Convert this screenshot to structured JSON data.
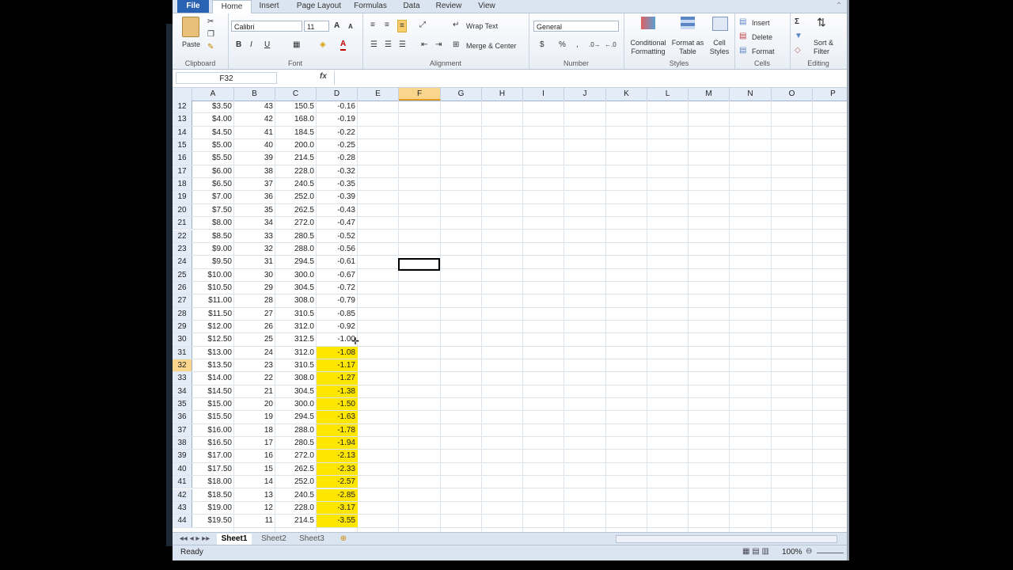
{
  "ribbon_tabs": [
    "File",
    "Home",
    "Insert",
    "Page Layout",
    "Formulas",
    "Data",
    "Review",
    "View"
  ],
  "clipboard": {
    "paste": "Paste",
    "label": "Clipboard"
  },
  "font": {
    "name": "Calibri",
    "size": "11",
    "label": "Font"
  },
  "alignment": {
    "wrap": "Wrap Text",
    "merge": "Merge & Center",
    "label": "Alignment"
  },
  "number": {
    "format": "General",
    "dollar": "$",
    "percent": "%",
    "comma": ",",
    "label": "Number"
  },
  "styles": {
    "conditional": "Conditional Formatting",
    "format_table": "Format as Table",
    "cell_styles": "Cell Styles",
    "label": "Styles"
  },
  "cells": {
    "insert": "Insert",
    "delete": "Delete",
    "format": "Format",
    "label": "Cells"
  },
  "editing": {
    "sort": "Sort & Filter",
    "label": "Editing",
    "sigma": "Σ"
  },
  "namebox": "F32",
  "fx": "fx",
  "columns": [
    "A",
    "B",
    "C",
    "D",
    "E",
    "F",
    "G",
    "H",
    "I",
    "J",
    "K",
    "L",
    "M",
    "N",
    "O",
    "P"
  ],
  "selected_col": "F",
  "selected_row": "32",
  "rows": [
    {
      "n": "12",
      "a": "$3.50",
      "b": "43",
      "c": "150.5",
      "d": "-0.16",
      "hl": false
    },
    {
      "n": "13",
      "a": "$4.00",
      "b": "42",
      "c": "168.0",
      "d": "-0.19",
      "hl": false
    },
    {
      "n": "14",
      "a": "$4.50",
      "b": "41",
      "c": "184.5",
      "d": "-0.22",
      "hl": false
    },
    {
      "n": "15",
      "a": "$5.00",
      "b": "40",
      "c": "200.0",
      "d": "-0.25",
      "hl": false
    },
    {
      "n": "16",
      "a": "$5.50",
      "b": "39",
      "c": "214.5",
      "d": "-0.28",
      "hl": false
    },
    {
      "n": "17",
      "a": "$6.00",
      "b": "38",
      "c": "228.0",
      "d": "-0.32",
      "hl": false
    },
    {
      "n": "18",
      "a": "$6.50",
      "b": "37",
      "c": "240.5",
      "d": "-0.35",
      "hl": false
    },
    {
      "n": "19",
      "a": "$7.00",
      "b": "36",
      "c": "252.0",
      "d": "-0.39",
      "hl": false
    },
    {
      "n": "20",
      "a": "$7.50",
      "b": "35",
      "c": "262.5",
      "d": "-0.43",
      "hl": false
    },
    {
      "n": "21",
      "a": "$8.00",
      "b": "34",
      "c": "272.0",
      "d": "-0.47",
      "hl": false
    },
    {
      "n": "22",
      "a": "$8.50",
      "b": "33",
      "c": "280.5",
      "d": "-0.52",
      "hl": false
    },
    {
      "n": "23",
      "a": "$9.00",
      "b": "32",
      "c": "288.0",
      "d": "-0.56",
      "hl": false
    },
    {
      "n": "24",
      "a": "$9.50",
      "b": "31",
      "c": "294.5",
      "d": "-0.61",
      "hl": false
    },
    {
      "n": "25",
      "a": "$10.00",
      "b": "30",
      "c": "300.0",
      "d": "-0.67",
      "hl": false
    },
    {
      "n": "26",
      "a": "$10.50",
      "b": "29",
      "c": "304.5",
      "d": "-0.72",
      "hl": false
    },
    {
      "n": "27",
      "a": "$11.00",
      "b": "28",
      "c": "308.0",
      "d": "-0.79",
      "hl": false
    },
    {
      "n": "28",
      "a": "$11.50",
      "b": "27",
      "c": "310.5",
      "d": "-0.85",
      "hl": false
    },
    {
      "n": "29",
      "a": "$12.00",
      "b": "26",
      "c": "312.0",
      "d": "-0.92",
      "hl": false
    },
    {
      "n": "30",
      "a": "$12.50",
      "b": "25",
      "c": "312.5",
      "d": "-1.00",
      "hl": false
    },
    {
      "n": "31",
      "a": "$13.00",
      "b": "24",
      "c": "312.0",
      "d": "-1.08",
      "hl": true
    },
    {
      "n": "32",
      "a": "$13.50",
      "b": "23",
      "c": "310.5",
      "d": "-1.17",
      "hl": true
    },
    {
      "n": "33",
      "a": "$14.00",
      "b": "22",
      "c": "308.0",
      "d": "-1.27",
      "hl": true
    },
    {
      "n": "34",
      "a": "$14.50",
      "b": "21",
      "c": "304.5",
      "d": "-1.38",
      "hl": true
    },
    {
      "n": "35",
      "a": "$15.00",
      "b": "20",
      "c": "300.0",
      "d": "-1.50",
      "hl": true
    },
    {
      "n": "36",
      "a": "$15.50",
      "b": "19",
      "c": "294.5",
      "d": "-1.63",
      "hl": true
    },
    {
      "n": "37",
      "a": "$16.00",
      "b": "18",
      "c": "288.0",
      "d": "-1.78",
      "hl": true
    },
    {
      "n": "38",
      "a": "$16.50",
      "b": "17",
      "c": "280.5",
      "d": "-1.94",
      "hl": true
    },
    {
      "n": "39",
      "a": "$17.00",
      "b": "16",
      "c": "272.0",
      "d": "-2.13",
      "hl": true
    },
    {
      "n": "40",
      "a": "$17.50",
      "b": "15",
      "c": "262.5",
      "d": "-2.33",
      "hl": true
    },
    {
      "n": "41",
      "a": "$18.00",
      "b": "14",
      "c": "252.0",
      "d": "-2.57",
      "hl": true
    },
    {
      "n": "42",
      "a": "$18.50",
      "b": "13",
      "c": "240.5",
      "d": "-2.85",
      "hl": true
    },
    {
      "n": "43",
      "a": "$19.00",
      "b": "12",
      "c": "228.0",
      "d": "-3.17",
      "hl": true
    },
    {
      "n": "44",
      "a": "$19.50",
      "b": "11",
      "c": "214.5",
      "d": "-3.55",
      "hl": true
    }
  ],
  "sheets": [
    "Sheet1",
    "Sheet2",
    "Sheet3"
  ],
  "status": "Ready",
  "zoom": "100%",
  "highlight_color": "#ffe600"
}
